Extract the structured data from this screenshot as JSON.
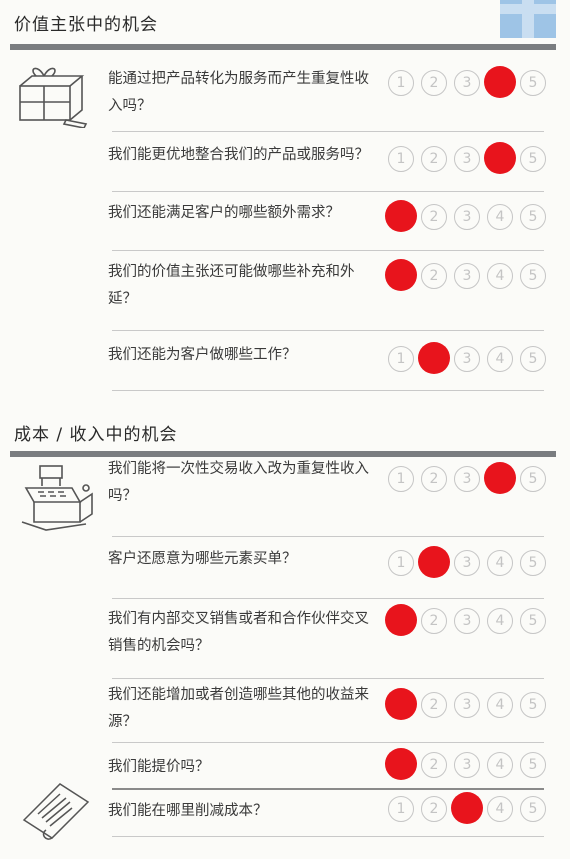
{
  "sections": [
    {
      "title": "价值主张中的机会",
      "questions": [
        {
          "text": "能通过把产品转化为服务而产生重复性收入吗？",
          "selected": 4
        },
        {
          "text": "我们能更优地整合我们的产品或服务吗？",
          "selected": 4
        },
        {
          "text": "我们还能满足客户的哪些额外需求？",
          "selected": 1
        },
        {
          "text": "我们的价值主张还可能做哪些补充和外延？",
          "selected": 1
        },
        {
          "text": "我们还能为客户做哪些工作？",
          "selected": 2
        }
      ]
    },
    {
      "title": "成本 / 收入中的机会",
      "questions": [
        {
          "text": "我们能将一次性交易收入改为重复性收入吗？",
          "selected": 4
        },
        {
          "text": "客户还愿意为哪些元素买单？",
          "selected": 2
        },
        {
          "text": "我们有内部交叉销售或者和合作伙伴交叉销售的机会吗？",
          "selected": 1
        },
        {
          "text": "我们还能增加或者创造哪些其他的收益来源？",
          "selected": 1
        },
        {
          "text": "我们能提价吗？",
          "selected": 1
        },
        {
          "text": "我们能在哪里削减成本？",
          "selected": 3
        }
      ]
    }
  ],
  "scale_labels": [
    "1",
    "2",
    "3",
    "4",
    "5"
  ],
  "colors": {
    "mark": "#e8141c",
    "rule": "#7a7d80",
    "accent": "#9ec4e6"
  },
  "icons": [
    "gift-box-icon",
    "cash-register-icon",
    "receipt-icon"
  ]
}
